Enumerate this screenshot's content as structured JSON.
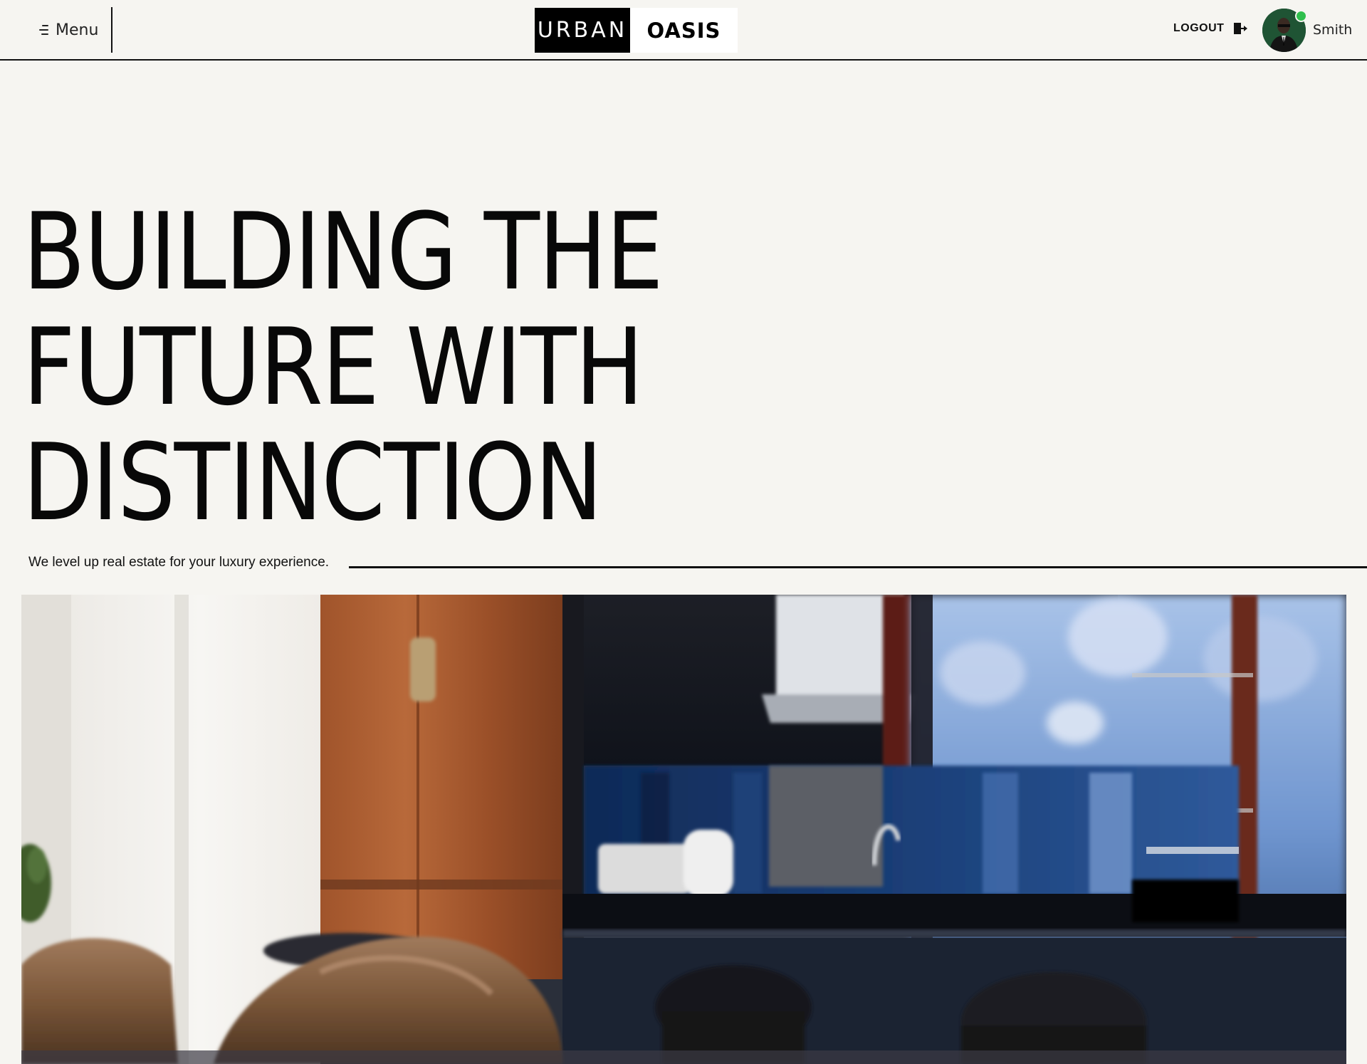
{
  "header": {
    "menu_label": "Menu",
    "menu_icon": "hamburger-menu-icon",
    "logo": {
      "left": "URBAN",
      "right": "OASIS"
    },
    "logout_label": "LOGOUT",
    "logout_icon": "logout-icon",
    "user": {
      "name": "Smith",
      "status": "online",
      "status_color": "#2fbf4d"
    }
  },
  "hero": {
    "title_lines": [
      "BUILDING THE",
      "FUTURE WITH",
      "DISTINCTION"
    ],
    "tagline": "We level up real estate for your luxury experience."
  },
  "colors": {
    "background": "#f6f5f1",
    "text": "#0b0b0b",
    "logo_dark": "#000000",
    "logo_light": "#ffffff"
  }
}
